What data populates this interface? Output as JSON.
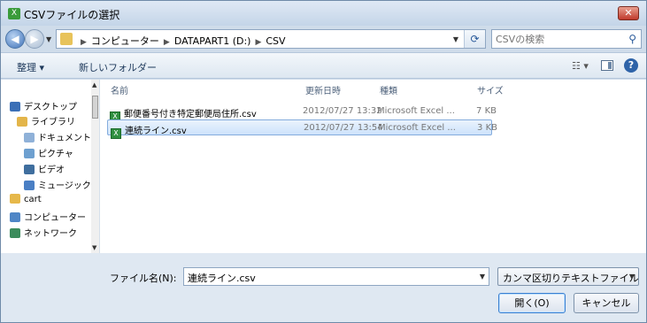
{
  "window": {
    "title": "CSVファイルの選択",
    "close_label": "✕"
  },
  "nav": {
    "breadcrumbs": [
      "コンピューター",
      "DATAPART1 (D:)",
      "CSV"
    ],
    "search_placeholder": "CSVの検索"
  },
  "toolbar": {
    "organize_label": "整理 ▾",
    "new_folder_label": "新しいフォルダー",
    "views_label": "☷ ▾"
  },
  "sidebar": {
    "items": [
      {
        "label": "デスクトップ",
        "icon": "desktop-icon",
        "color": "#3b6fb6"
      },
      {
        "label": "ライブラリ",
        "icon": "library-icon",
        "color": "#e3b54a"
      },
      {
        "label": "ドキュメント",
        "icon": "documents-icon",
        "color": "#8fb1d8"
      },
      {
        "label": "ピクチャ",
        "icon": "pictures-icon",
        "color": "#6ea0d0"
      },
      {
        "label": "ビデオ",
        "icon": "videos-icon",
        "color": "#3f6e9e"
      },
      {
        "label": "ミュージック",
        "icon": "music-icon",
        "color": "#4a7fc4"
      },
      {
        "label": "cart",
        "icon": "user-folder-icon",
        "color": "#e6b84a"
      },
      {
        "label": "コンピューター",
        "icon": "computer-icon",
        "color": "#4f86c6"
      },
      {
        "label": "ネットワーク",
        "icon": "network-icon",
        "color": "#3c8c5c"
      }
    ]
  },
  "filelist": {
    "columns": {
      "name": "名前",
      "date": "更新日時",
      "type": "種類",
      "size": "サイズ"
    },
    "rows": [
      {
        "name": "郵便番号付き特定郵便局住所.csv",
        "date": "2012/07/27 13:32",
        "type": "Microsoft Excel ...",
        "size": "7 KB",
        "selected": false
      },
      {
        "name": "連続ライン.csv",
        "date": "2012/07/27 13:54",
        "type": "Microsoft Excel ...",
        "size": "3 KB",
        "selected": true
      }
    ]
  },
  "bottom": {
    "filename_label": "ファイル名(N):",
    "filename_value": "連続ライン.csv",
    "filetype_value": "カンマ区切りテキストファイル",
    "open_label": "開く(O)",
    "cancel_label": "キャンセル"
  }
}
